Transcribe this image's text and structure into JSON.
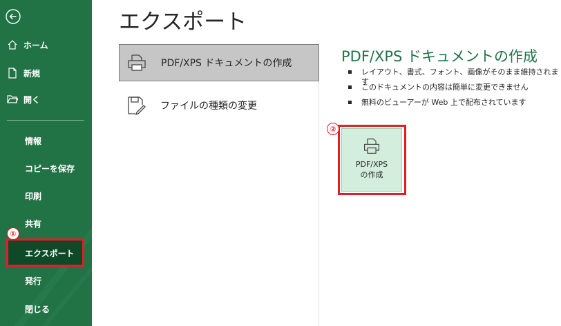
{
  "sidebar": {
    "back_icon": "back-arrow-icon",
    "top_items": [
      {
        "label": "ホーム",
        "icon": "home-icon"
      },
      {
        "label": "新規",
        "icon": "new-document-icon"
      },
      {
        "label": "開く",
        "icon": "open-folder-icon"
      }
    ],
    "items": [
      {
        "label": "情報"
      },
      {
        "label": "コピーを保存"
      },
      {
        "label": "印刷"
      },
      {
        "label": "共有"
      },
      {
        "label": "エクスポート",
        "selected": true
      },
      {
        "label": "発行"
      },
      {
        "label": "閉じる"
      }
    ],
    "color": "#217346",
    "selected_color": "#0f4a28"
  },
  "main": {
    "title": "エクスポート",
    "options": [
      {
        "label": "PDF/XPS ドキュメントの作成",
        "icon": "pdf-document-icon",
        "selected": true
      },
      {
        "label": "ファイルの種類の変更",
        "icon": "change-file-type-icon"
      }
    ],
    "detail": {
      "title": "PDF/XPS ドキュメントの作成",
      "bullets": [
        "レイアウト、書式、フォント、画像がそのまま維持されます",
        "このドキュメントの内容は簡単に変更できません",
        "無料のビューアーが Web 上で配布されています"
      ],
      "button_line1": "PDF/XPS",
      "button_line2": "の作成"
    },
    "accent": "#217346"
  },
  "annotations": {
    "badge1": "①",
    "badge2": "②",
    "highlight_color": "#e51c23"
  }
}
